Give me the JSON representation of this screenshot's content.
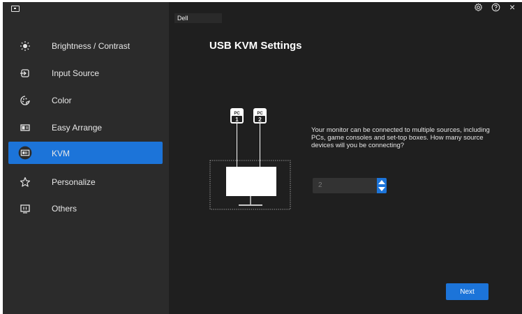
{
  "app": {
    "brand_label": "Dell"
  },
  "sidebar": {
    "items": [
      {
        "label": "Brightness / Contrast",
        "icon": "brightness-icon"
      },
      {
        "label": "Input Source",
        "icon": "input-source-icon"
      },
      {
        "label": "Color",
        "icon": "color-icon"
      },
      {
        "label": "Easy Arrange",
        "icon": "easy-arrange-icon"
      },
      {
        "label": "KVM",
        "icon": "kvm-icon",
        "active": true
      },
      {
        "label": "Personalize",
        "icon": "star-icon"
      },
      {
        "label": "Others",
        "icon": "others-icon"
      }
    ]
  },
  "header": {
    "settings_icon": "gear-icon",
    "help_icon": "help-icon",
    "close_icon": "close-icon",
    "close_glyph": "×"
  },
  "main": {
    "title": "USB KVM Settings",
    "description": "Your monitor can be connected to multiple sources, including PCs, game consoles and set-top boxes. How many source devices will you be connecting?",
    "diagram": {
      "pc1_tag": "PC",
      "pc1_num": "1",
      "pc2_tag": "PC",
      "pc2_num": "2"
    },
    "source_count": {
      "value": "2"
    },
    "next_label": "Next"
  },
  "colors": {
    "accent": "#1c74d9",
    "sidebar_bg": "#2b2b2b",
    "main_bg": "#1f1f1f"
  }
}
